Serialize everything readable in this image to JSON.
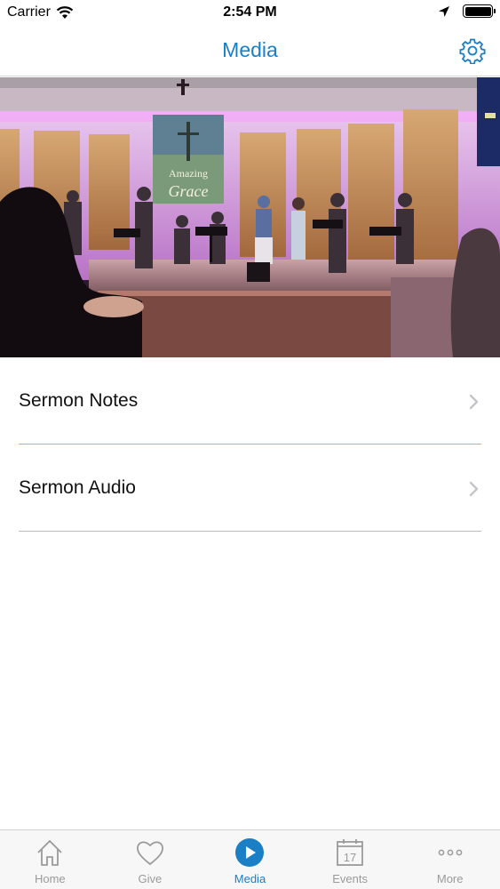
{
  "status_bar": {
    "carrier": "Carrier",
    "time": "2:54 PM"
  },
  "nav": {
    "title": "Media"
  },
  "hero": {
    "banner_line1": "Amazing",
    "banner_line2": "Grace"
  },
  "list": {
    "items": [
      {
        "label": "Sermon Notes"
      },
      {
        "label": "Sermon Audio"
      }
    ]
  },
  "tabs": [
    {
      "label": "Home",
      "icon": "home-icon",
      "active": false
    },
    {
      "label": "Give",
      "icon": "heart-icon",
      "active": false
    },
    {
      "label": "Media",
      "icon": "play-icon",
      "active": true
    },
    {
      "label": "Events",
      "icon": "calendar-icon",
      "active": false,
      "badge": "17"
    },
    {
      "label": "More",
      "icon": "more-icon",
      "active": false
    }
  ],
  "colors": {
    "accent": "#1a7fc4",
    "tab_inactive": "#9a9a9a"
  }
}
